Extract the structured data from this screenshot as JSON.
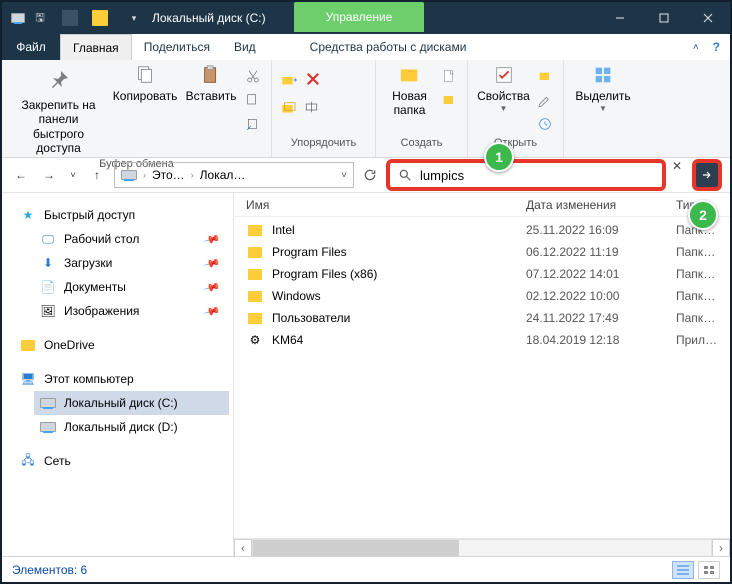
{
  "titlebar": {
    "title": "Локальный диск (C:)",
    "manage_tab": "Управление"
  },
  "tabs": {
    "file": "Файл",
    "home": "Главная",
    "share": "Поделиться",
    "view": "Вид",
    "drive_tools": "Средства работы с дисками"
  },
  "ribbon": {
    "pin": "Закрепить на панели быстрого доступа",
    "copy": "Копировать",
    "paste": "Вставить",
    "clipboard_group": "Буфер обмена",
    "organize_group": "Упорядочить",
    "new_folder": "Новая папка",
    "create_group": "Создать",
    "properties": "Свойства",
    "open_group": "Открыть",
    "select": "Выделить"
  },
  "address": {
    "crumb1": "Это…",
    "crumb2": "Локал…"
  },
  "search": {
    "value": "lumpics"
  },
  "tree": {
    "quick": "Быстрый доступ",
    "desktop": "Рабочий стол",
    "downloads": "Загрузки",
    "documents": "Документы",
    "pictures": "Изображения",
    "onedrive": "OneDrive",
    "thispc": "Этот компьютер",
    "drive_c": "Локальный диск (C:)",
    "drive_d": "Локальный диск (D:)",
    "network": "Сеть"
  },
  "columns": {
    "name": "Имя",
    "modified": "Дата изменения",
    "type": "Тип"
  },
  "files": [
    {
      "name": "Intel",
      "date": "25.11.2022 16:09",
      "type": "Папка с фай",
      "kind": "folder"
    },
    {
      "name": "Program Files",
      "date": "06.12.2022 11:19",
      "type": "Папка с фай",
      "kind": "folder"
    },
    {
      "name": "Program Files (x86)",
      "date": "07.12.2022 14:01",
      "type": "Папка с фай",
      "kind": "folder"
    },
    {
      "name": "Windows",
      "date": "02.12.2022 10:00",
      "type": "Папка с фай",
      "kind": "folder"
    },
    {
      "name": "Пользователи",
      "date": "24.11.2022 17:49",
      "type": "Папка с фай",
      "kind": "folder"
    },
    {
      "name": "KM64",
      "date": "18.04.2019 12:18",
      "type": "Приложени",
      "kind": "app"
    }
  ],
  "status": {
    "count": "Элементов: 6"
  },
  "badges": {
    "b1": "1",
    "b2": "2"
  }
}
